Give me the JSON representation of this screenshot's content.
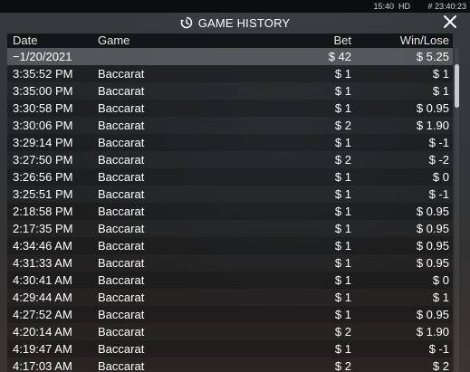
{
  "status_bar": {
    "clock": "15:40",
    "quality": "HD",
    "round_id": "# 23:40:23"
  },
  "window": {
    "title": "GAME HISTORY",
    "icons": {
      "history": "history-icon",
      "close": "close-icon"
    }
  },
  "table": {
    "headers": {
      "date": "Date",
      "game": "Game",
      "bet": "Bet",
      "win_lose": "Win/Lose"
    },
    "date_group": {
      "date": "−1/20/2021",
      "bet_total": "$ 42",
      "win_total": "$ 5.25"
    },
    "rows": [
      {
        "time": "3:35:52 PM",
        "game": "Baccarat",
        "bet": "$ 1",
        "win": "$ 1"
      },
      {
        "time": "3:35:00 PM",
        "game": "Baccarat",
        "bet": "$ 1",
        "win": "$ 1"
      },
      {
        "time": "3:30:58 PM",
        "game": "Baccarat",
        "bet": "$ 1",
        "win": "$ 0.95"
      },
      {
        "time": "3:30:06 PM",
        "game": "Baccarat",
        "bet": "$ 2",
        "win": "$ 1.90"
      },
      {
        "time": "3:29:14 PM",
        "game": "Baccarat",
        "bet": "$ 1",
        "win": "$ -1"
      },
      {
        "time": "3:27:50 PM",
        "game": "Baccarat",
        "bet": "$ 2",
        "win": "$ -2"
      },
      {
        "time": "3:26:56 PM",
        "game": "Baccarat",
        "bet": "$ 1",
        "win": "$ 0"
      },
      {
        "time": "3:25:51 PM",
        "game": "Baccarat",
        "bet": "$ 1",
        "win": "$ -1"
      },
      {
        "time": "2:18:58 PM",
        "game": "Baccarat",
        "bet": "$ 1",
        "win": "$ 0.95"
      },
      {
        "time": "2:17:35 PM",
        "game": "Baccarat",
        "bet": "$ 1",
        "win": "$ 0.95"
      },
      {
        "time": "4:34:46 AM",
        "game": "Baccarat",
        "bet": "$ 1",
        "win": "$ 0.95"
      },
      {
        "time": "4:31:33 AM",
        "game": "Baccarat",
        "bet": "$ 1",
        "win": "$ 0.95"
      },
      {
        "time": "4:30:41 AM",
        "game": "Baccarat",
        "bet": "$ 1",
        "win": "$ 0"
      },
      {
        "time": "4:29:44 AM",
        "game": "Baccarat",
        "bet": "$ 1",
        "win": "$ 1"
      },
      {
        "time": "4:27:52 AM",
        "game": "Baccarat",
        "bet": "$ 1",
        "win": "$ 0.95"
      },
      {
        "time": "4:20:14 AM",
        "game": "Baccarat",
        "bet": "$ 2",
        "win": "$ 1.90"
      },
      {
        "time": "4:19:47 AM",
        "game": "Baccarat",
        "bet": "$ 1",
        "win": "$ -1"
      },
      {
        "time": "4:17:03 AM",
        "game": "Baccarat",
        "bet": "$ 2",
        "win": "$ 2"
      }
    ]
  },
  "colors": {
    "header_bg": "#131516",
    "date_group_bg": "#6e7072",
    "text": "#ffffff",
    "scroll_thumb": "#c9cacb"
  }
}
